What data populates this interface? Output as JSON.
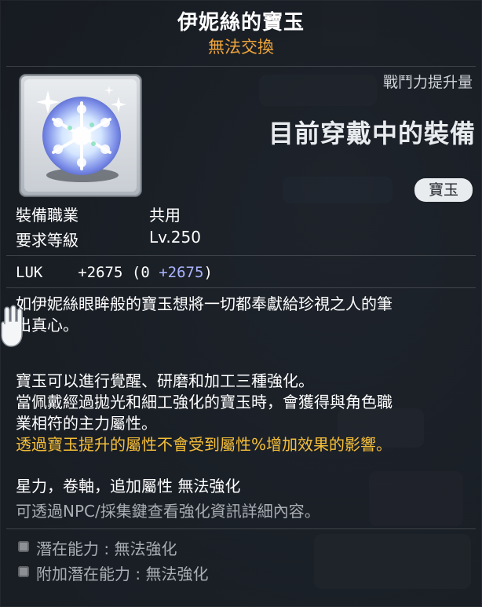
{
  "item": {
    "name": "伊妮絲的寶玉",
    "trade_status": "無法交換",
    "category_badge": "寶玉"
  },
  "combat_power": {
    "label": "戰鬥力提升量",
    "value": "目前穿戴中的裝備"
  },
  "requirements": {
    "job_label": "裝備職業",
    "job_value": "共用",
    "level_label": "要求等級",
    "level_value": "Lv.250"
  },
  "stats": {
    "stat_name": "LUK",
    "total": "+2675",
    "base": "(0",
    "bonus": "+2675",
    "close": ")"
  },
  "description": {
    "flavor_line1": "如伊妮絲眼眸般的寶玉想將一切都奉獻給珍視之人的筆",
    "flavor_line2": "出真心。",
    "enhance_line1": "寶玉可以進行覺醒、研磨和加工三種強化。",
    "enhance_line2": "當佩戴經過拋光和細工強化的寶玉時，會獲得與角色職",
    "enhance_line3": "業相符的主力屬性。",
    "warning": "透過寶玉提升的屬性不會受到屬性%增加效果的影響。",
    "restriction": "星力，卷軸，追加屬性 無法強化",
    "npc_hint": "可透過NPC/採集鍵查看強化資訊詳細內容。"
  },
  "potentials": [
    {
      "label": "潛在能力 : 無法強化"
    },
    {
      "label": "附加潛在能力 : 無法強化"
    }
  ],
  "colors": {
    "title": "#ffffff",
    "untradable": "#f0a63b",
    "warning": "#f6bf38",
    "stat_bonus": "#aab4ff",
    "muted": "#a9aeb4"
  },
  "icons": {
    "item": "snowflake-jewel-icon",
    "cursor": "glove-hand-cursor-icon"
  }
}
